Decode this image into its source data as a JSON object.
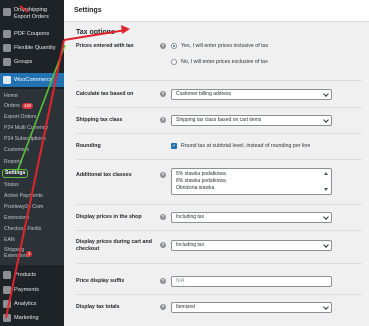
{
  "sidebar": {
    "top_items": [
      {
        "label": "Dropshipping Export Orders",
        "icon": "export-icon"
      },
      {
        "label": "PDF Coupons",
        "icon": "pdf-icon"
      },
      {
        "label": "Flexible Quantity",
        "icon": "quantity-icon"
      },
      {
        "label": "Groups",
        "icon": "groups-icon"
      }
    ],
    "woocommerce_label": "WooCommerce",
    "sub_items": [
      {
        "label": "Home"
      },
      {
        "label": "Orders",
        "badge": "140"
      },
      {
        "label": "Export Orders"
      },
      {
        "label": "P24 Multi Currency"
      },
      {
        "label": "P24 Subscriptions"
      },
      {
        "label": "Customers"
      },
      {
        "label": "Reports"
      },
      {
        "label": "Settings",
        "active": true
      },
      {
        "label": "Status"
      },
      {
        "label": "Active Payments"
      },
      {
        "label": "Przelewy24 Com"
      },
      {
        "label": "Extensions"
      },
      {
        "label": "Checkout Fields"
      },
      {
        "label": "EAN"
      },
      {
        "label": "Shipping Extensions",
        "badge": "1"
      }
    ],
    "bottom_items": [
      {
        "label": "Products",
        "icon": "products-icon"
      },
      {
        "label": "Payments",
        "icon": "payments-icon"
      },
      {
        "label": "Analytics",
        "icon": "analytics-icon"
      },
      {
        "label": "Marketing",
        "icon": "marketing-icon"
      }
    ]
  },
  "header": {
    "title": "Settings"
  },
  "tax_options": {
    "section_title": "Tax options",
    "prices_entered_label": "Prices entered with tax",
    "prices_option_yes": "Yes, I will enter prices inclusive of tax",
    "prices_option_no": "No, I will enter prices exclusive of tax",
    "calc_based_label": "Calculate tax based on",
    "calc_based_value": "Customer billing address",
    "shipping_class_label": "Shipping tax class",
    "shipping_class_value": "Shipping tax class based on cart items",
    "rounding_label": "Rounding",
    "rounding_text": "Round tax at subtotal level, instead of rounding per line",
    "additional_label": "Additional tax classes",
    "additional_classes": [
      "5% stawka podatkowa",
      "8% stawka podatkowa",
      "Obniżona stawka"
    ],
    "display_shop_label": "Display prices in the shop",
    "display_shop_value": "Including tax",
    "display_cart_label": "Display prices during cart and checkout",
    "display_cart_value": "Including tax",
    "suffix_label": "Price display suffix",
    "suffix_placeholder": "N/A",
    "totals_label": "Display tax totals",
    "totals_value": "Itemized",
    "help_glyph": "?"
  },
  "colors": {
    "sidebar_bg": "#1d2327",
    "accent": "#2271b1",
    "annotation_red": "#e0242c",
    "annotation_green": "#5bbf3a"
  }
}
